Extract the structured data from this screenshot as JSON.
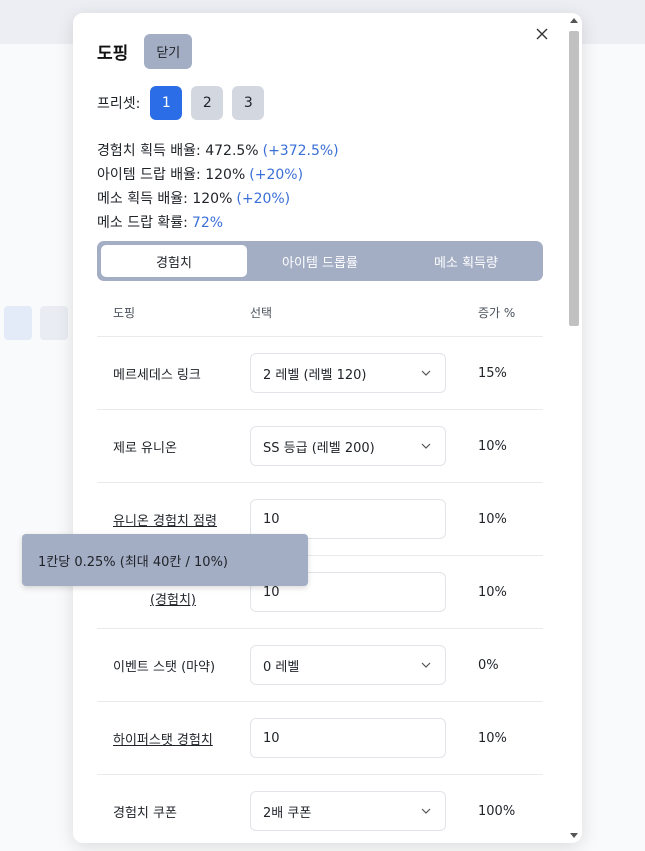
{
  "modal": {
    "title": "도핑",
    "close_label": "닫기",
    "preset_label": "프리셋:",
    "presets": [
      "1",
      "2",
      "3"
    ],
    "active_preset": "1"
  },
  "stats": [
    {
      "label": "경험치 획득 배율: 472.5%",
      "delta": "(+372.5%)"
    },
    {
      "label": "아이템 드랍 배율: 120%",
      "delta": "(+20%)"
    },
    {
      "label": "메소 획득 배율: 120%",
      "delta": "(+20%)"
    },
    {
      "label": "메소 드랍 확률:",
      "delta": "72%"
    }
  ],
  "tabs": [
    "경험치",
    "아이템 드롭률",
    "메소 획득량"
  ],
  "table": {
    "headers": [
      "도핑",
      "선택",
      "증가 %"
    ],
    "rows": [
      {
        "name": "메르세데스 링크",
        "value": "2 레벨 (레벨 120)",
        "pct": "15%"
      },
      {
        "name": "제로 유니온",
        "value": "SS 등급 (레벨 200)",
        "pct": "10%"
      },
      {
        "name": "유니온 경험치 점령",
        "value": "10",
        "pct": "10%"
      },
      {
        "name": "(경험치)",
        "value": "10",
        "pct": "10%"
      },
      {
        "name": "이벤트 스탯 (마약)",
        "value": "0 레벨",
        "pct": "0%"
      },
      {
        "name": "하이퍼스탯 경험치",
        "value": "10",
        "pct": "10%"
      },
      {
        "name": "경험치 쿠폰",
        "value": "2배 쿠폰",
        "pct": "100%"
      }
    ]
  },
  "tooltip": "1칸당 0.25% (최대 40칸 / 10%)",
  "colors": {
    "accent": "#2b6de6",
    "delta": "#3b6fd8",
    "slate": "#a3adc4"
  }
}
